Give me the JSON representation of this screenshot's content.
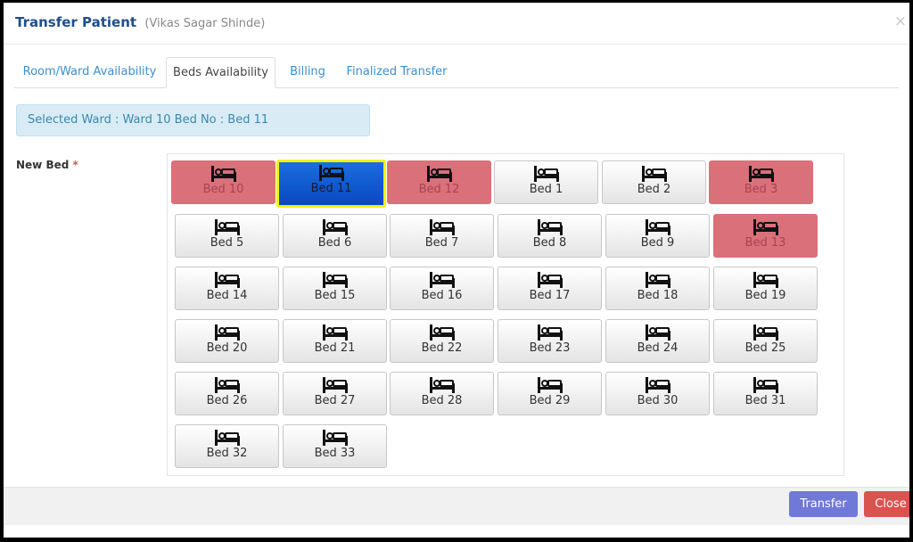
{
  "dialog": {
    "title": "Transfer Patient",
    "patient_name": "(Vikas Sagar Shinde)",
    "close_glyph": "×"
  },
  "tabs": [
    {
      "label": "Room/Ward Availability",
      "active": false
    },
    {
      "label": "Beds Availability",
      "active": true
    },
    {
      "label": "Billing",
      "active": false
    },
    {
      "label": "Finalized Transfer",
      "active": false
    }
  ],
  "info_text": "Selected Ward : Ward 10 Bed No : Bed 11",
  "new_bed": {
    "label": "New Bed",
    "required_mark": "*"
  },
  "bed_icon": "bed-icon",
  "colors": {
    "occupied": "#d9707a",
    "selected": "#0a57d1",
    "selected_border": "#f2f20a",
    "available": "#eeeeee"
  },
  "beds": [
    {
      "label": "Bed 10",
      "status": "occupied"
    },
    {
      "label": "Bed 11",
      "status": "selected"
    },
    {
      "label": "Bed 12",
      "status": "occupied"
    },
    {
      "label": "Bed 1",
      "status": "available"
    },
    {
      "label": "Bed 2",
      "status": "available"
    },
    {
      "label": "Bed 3",
      "status": "occupied"
    },
    {
      "label": "Bed 5",
      "status": "available"
    },
    {
      "label": "Bed 6",
      "status": "available"
    },
    {
      "label": "Bed 7",
      "status": "available"
    },
    {
      "label": "Bed 8",
      "status": "available"
    },
    {
      "label": "Bed 9",
      "status": "available"
    },
    {
      "label": "Bed 13",
      "status": "occupied"
    },
    {
      "label": "Bed 14",
      "status": "available"
    },
    {
      "label": "Bed 15",
      "status": "available"
    },
    {
      "label": "Bed 16",
      "status": "available"
    },
    {
      "label": "Bed 17",
      "status": "available"
    },
    {
      "label": "Bed 18",
      "status": "available"
    },
    {
      "label": "Bed 19",
      "status": "available"
    },
    {
      "label": "Bed 20",
      "status": "available"
    },
    {
      "label": "Bed 21",
      "status": "available"
    },
    {
      "label": "Bed 22",
      "status": "available"
    },
    {
      "label": "Bed 23",
      "status": "available"
    },
    {
      "label": "Bed 24",
      "status": "available"
    },
    {
      "label": "Bed 25",
      "status": "available"
    },
    {
      "label": "Bed 26",
      "status": "available"
    },
    {
      "label": "Bed 27",
      "status": "available"
    },
    {
      "label": "Bed 28",
      "status": "available"
    },
    {
      "label": "Bed 29",
      "status": "available"
    },
    {
      "label": "Bed 30",
      "status": "available"
    },
    {
      "label": "Bed 31",
      "status": "available"
    },
    {
      "label": "Bed 32",
      "status": "available"
    },
    {
      "label": "Bed 33",
      "status": "available"
    }
  ],
  "buttons": {
    "transfer": "Transfer",
    "close": "Close"
  }
}
